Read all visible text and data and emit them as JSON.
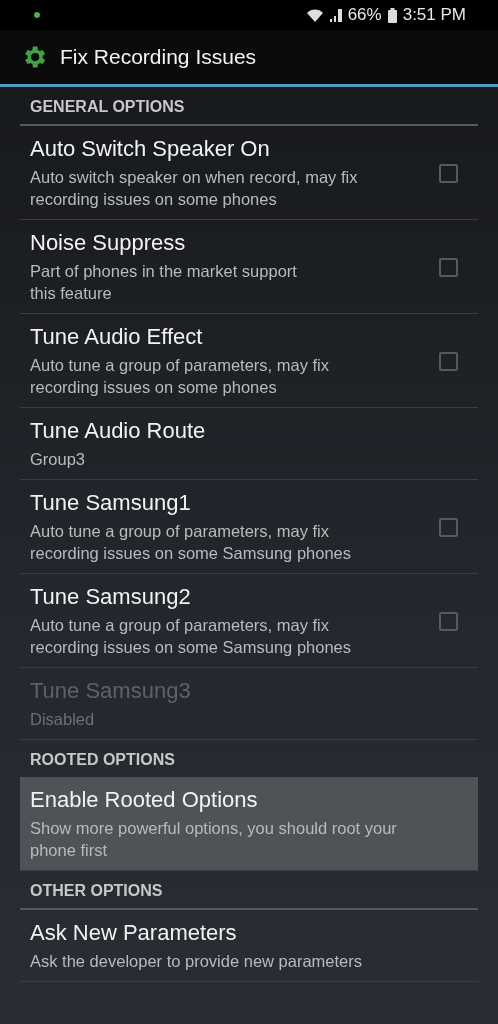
{
  "status_bar": {
    "battery": "66%",
    "time": "3:51 PM"
  },
  "toolbar": {
    "title": "Fix Recording Issues"
  },
  "sections": [
    {
      "header": "GENERAL OPTIONS",
      "items": [
        {
          "kind": "checkbox",
          "title": "Auto Switch Speaker On",
          "summary": "Auto switch speaker on when record, may fix recording issues on some phones",
          "checked": false,
          "disabled": false,
          "selected": false
        },
        {
          "kind": "checkbox",
          "title": "Noise Suppress",
          "summary": "Part of phones in the market support\nthis feature",
          "checked": false,
          "disabled": false,
          "selected": false
        },
        {
          "kind": "checkbox",
          "title": "Tune Audio Effect",
          "summary": "Auto tune a group of parameters, may fix recording issues on some phones",
          "checked": false,
          "disabled": false,
          "selected": false
        },
        {
          "kind": "plain",
          "title": "Tune Audio Route",
          "summary": "Group3",
          "disabled": false,
          "selected": false
        },
        {
          "kind": "checkbox",
          "title": "Tune Samsung1",
          "summary": "Auto tune a group of parameters, may fix recording issues on some Samsung phones",
          "checked": false,
          "disabled": false,
          "selected": false
        },
        {
          "kind": "checkbox",
          "title": "Tune Samsung2",
          "summary": "Auto tune a group of parameters, may fix recording issues on some Samsung phones",
          "checked": false,
          "disabled": false,
          "selected": false
        },
        {
          "kind": "plain",
          "title": "Tune Samsung3",
          "summary": "Disabled",
          "disabled": true,
          "selected": false
        }
      ]
    },
    {
      "header": "ROOTED OPTIONS",
      "items": [
        {
          "kind": "plain",
          "title": "Enable Rooted Options",
          "summary": "Show more powerful options, you should root your phone first",
          "disabled": false,
          "selected": true
        }
      ]
    },
    {
      "header": "OTHER OPTIONS",
      "items": [
        {
          "kind": "plain",
          "title": "Ask New Parameters",
          "summary": "Ask the developer to provide new parameters",
          "disabled": false,
          "selected": false
        }
      ]
    }
  ]
}
